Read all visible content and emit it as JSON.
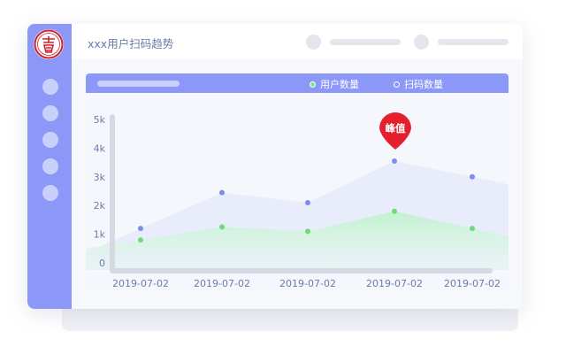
{
  "header": {
    "title": "xxx用户扫码趋势"
  },
  "legend": [
    {
      "label": "用户数量",
      "color": "#7ee88f"
    },
    {
      "label": "扫码数量",
      "color": "#ffffff"
    }
  ],
  "annotation": {
    "label": "峰值",
    "color": "#e5202e"
  },
  "colors": {
    "sidebar": "#8b98f8",
    "scan_series": "#7c8cf0",
    "user_series": "#6edb7a",
    "peak_marker": "#e5202e"
  },
  "chart_data": {
    "type": "area",
    "x": [
      "2019-07-02",
      "2019-07-02",
      "2019-07-02",
      "2019-07-02",
      "2019-07-02"
    ],
    "series": [
      {
        "name": "扫码数量",
        "values": [
          1200,
          2450,
          2100,
          3550,
          3000
        ]
      },
      {
        "name": "用户数量",
        "values": [
          800,
          1250,
          1100,
          1800,
          1200
        ]
      }
    ],
    "y_ticks": [
      "0",
      "1k",
      "2k",
      "3k",
      "4k",
      "5k"
    ],
    "ylim": [
      0,
      5000
    ],
    "grid": false,
    "legend_position": "top-right",
    "annotation": {
      "text": "峰值",
      "series_index": 0,
      "point_index": 3
    }
  }
}
